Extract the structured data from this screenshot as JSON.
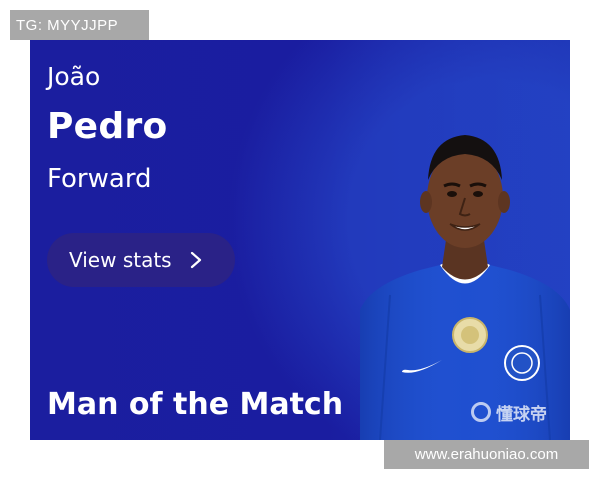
{
  "overlay": {
    "top_left_text": "TG: MYYJJPP",
    "bottom_right_text": "www.erahuoniao.com"
  },
  "card": {
    "first_name": "João",
    "last_name": "Pedro",
    "position": "Forward",
    "view_stats_label": "View stats",
    "title": "Man of the Match",
    "watermark_text": "懂球帝"
  },
  "icons": {
    "view_stats": "chevron-right-icon",
    "watermark": "dongqiudi-logo-icon"
  },
  "colors": {
    "card_background": "#1a1d9c",
    "button_background": "#2a2287",
    "overlay_badge": "#a8a8a8",
    "jersey": "#1f4fd0"
  }
}
